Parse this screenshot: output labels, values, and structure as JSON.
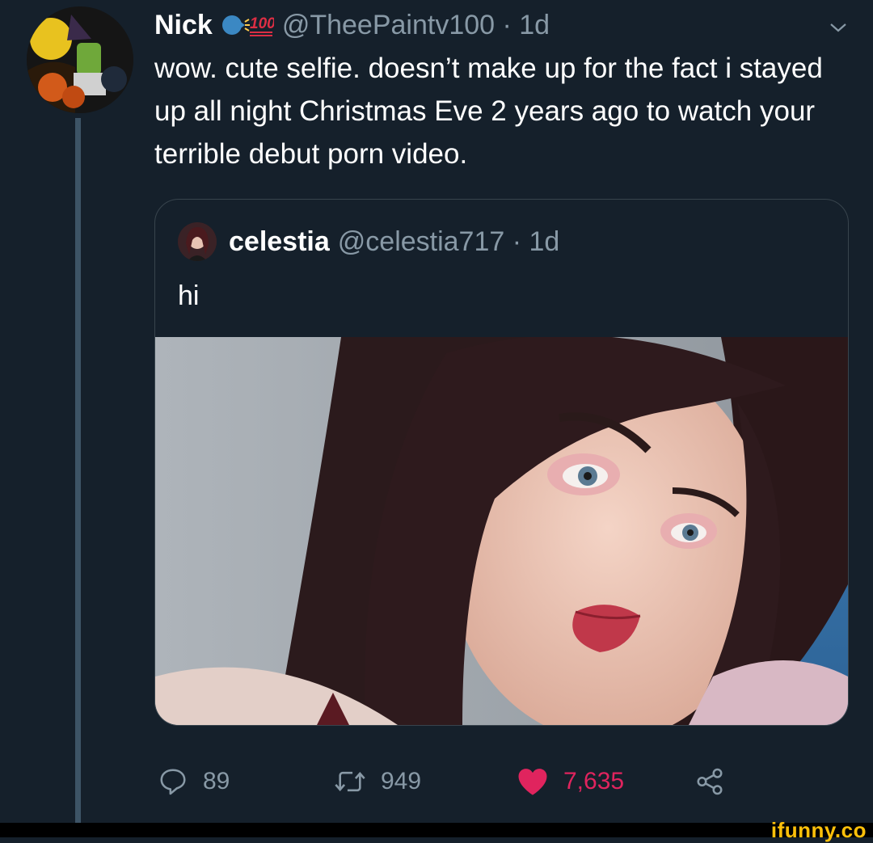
{
  "tweet": {
    "display_name": "Nick",
    "emoji": "🗣️💯",
    "handle_and_time": "@TheePaintv100 · 1d",
    "text": "wow. cute selfie. doesn’t make up for the fact i stayed up all night Christmas Eve 2 years ago to watch your terrible debut porn video."
  },
  "quote": {
    "display_name": "celestia",
    "handle_and_time": "@celestia717 · 1d",
    "text": "hi"
  },
  "actions": {
    "replies": "89",
    "retweets": "949",
    "likes": "7,635"
  },
  "watermark": {
    "text": "ifunny.co"
  },
  "colors": {
    "background": "#15202b",
    "secondary_text": "#8899a6",
    "like": "#e0245e",
    "border": "#38444d",
    "ifunny": "#ffc00a"
  },
  "icons": [
    "chevron-down-icon",
    "reply-icon",
    "retweet-icon",
    "heart-icon",
    "share-icon"
  ]
}
